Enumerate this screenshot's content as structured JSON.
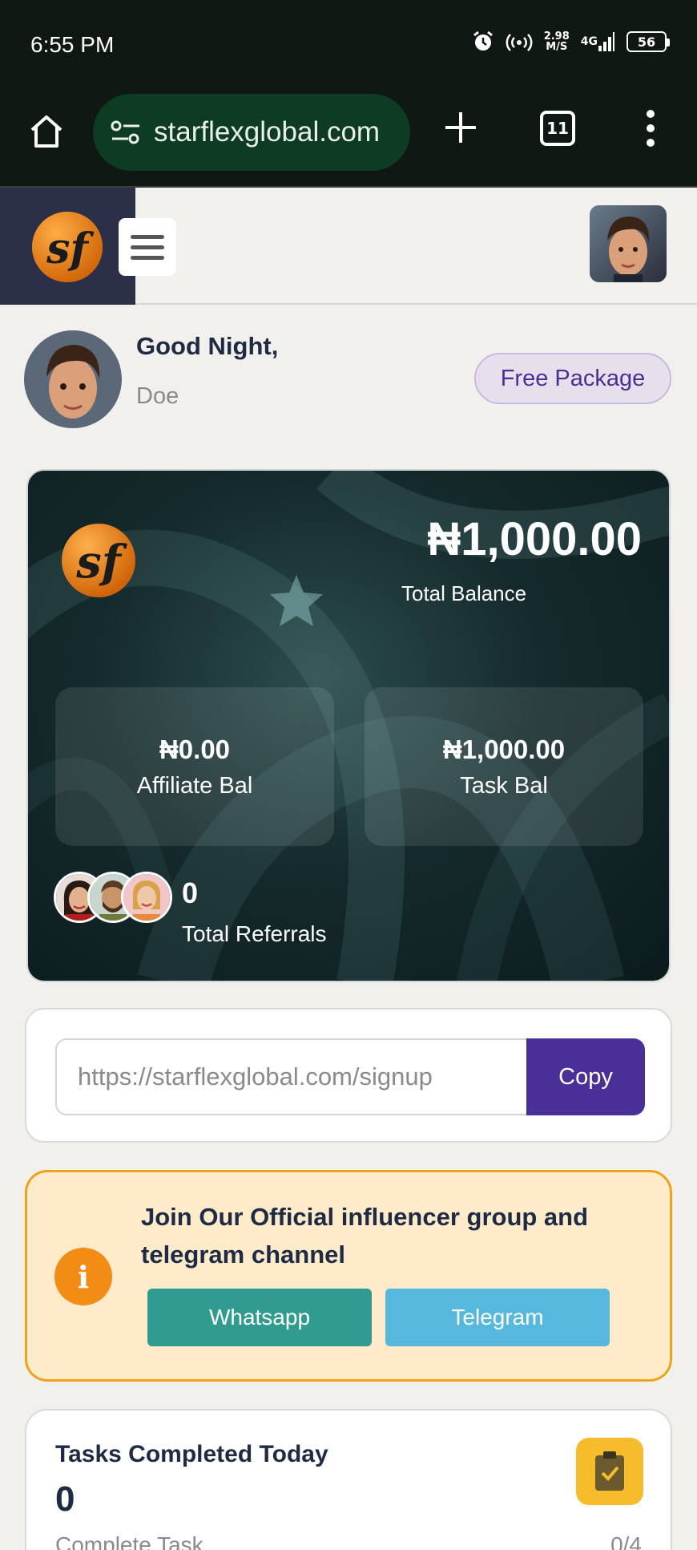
{
  "status_bar": {
    "time": "6:55 PM",
    "speed_value": "2.98",
    "speed_unit": "M/S",
    "network": "4G",
    "battery": "56",
    "icons": [
      "alarm-icon",
      "hotspot-icon",
      "signal-icon",
      "battery-icon"
    ]
  },
  "browser": {
    "url": "starflexglobal.com",
    "tab_count": "11",
    "icons": [
      "home-icon",
      "site-settings-icon",
      "new-tab-icon",
      "tabs-icon",
      "more-icon"
    ]
  },
  "header": {
    "logo_text": "sf"
  },
  "greeting": {
    "title": "Good Night,",
    "name": "Doe",
    "package": "Free Package"
  },
  "balance": {
    "total": "₦1,000.00",
    "total_label": "Total Balance",
    "affiliate_amount": "₦0.00",
    "affiliate_label": "Affiliate Bal",
    "task_amount": "₦1,000.00",
    "task_label": "Task Bal",
    "referrals_count": "0",
    "referrals_label": "Total Referrals"
  },
  "referral_link": {
    "url": "https://starflexglobal.com/signup",
    "copy_label": "Copy"
  },
  "community": {
    "title": "Join Our Official influencer group and telegram channel",
    "whatsapp_label": "Whatsapp",
    "telegram_label": "Telegram"
  },
  "tasks": {
    "title": "Tasks Completed Today",
    "count": "0",
    "subtitle": "Complete Task",
    "ratio": "0/4"
  },
  "colors": {
    "brand_purple": "#4a2f98",
    "brand_orange": "#f28c14",
    "whatsapp": "#2f9c8f",
    "telegram": "#56b8dc",
    "card_dark": "#152a2c"
  }
}
